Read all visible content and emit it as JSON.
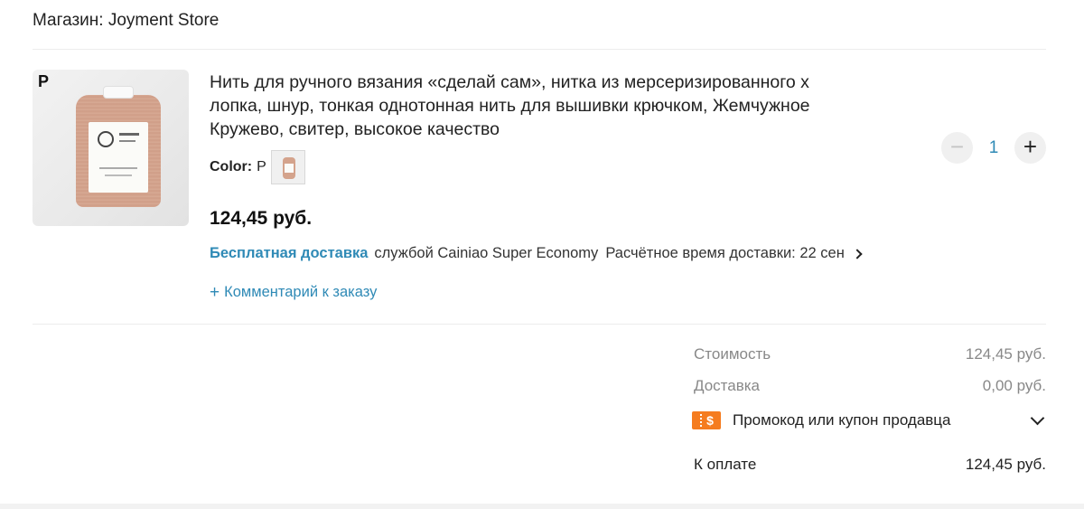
{
  "store": {
    "header": "Магазин: Joyment Store"
  },
  "product": {
    "image_variant_letter": "P",
    "title": "Нить для ручного вязания «сделай сам», нитка из мерсеризированного хлопка, шнур, тонкая однотонная нить для вышивки крючком, Жемчужное Кружево, свитер, высокое качество",
    "color_label": "Color:",
    "color_value": "P",
    "price": "124,45 руб.",
    "quantity": "1"
  },
  "shipping": {
    "free_label": "Бесплатная доставка",
    "carrier": "службой Cainiao Super Economy",
    "eta": "Расчётное время доставки: 22 сен"
  },
  "comment": {
    "label": "Комментарий к заказу"
  },
  "summary": {
    "cost_label": "Стоимость",
    "cost_value": "124,45 руб.",
    "delivery_label": "Доставка",
    "delivery_value": "0,00 руб.",
    "promo_label": "Промокод или купон продавца",
    "promo_icon_symbol": "$",
    "total_label": "К оплате",
    "total_value": "124,45 руб."
  },
  "colors": {
    "link": "#2f8ab6",
    "coupon": "#f57c1f"
  }
}
